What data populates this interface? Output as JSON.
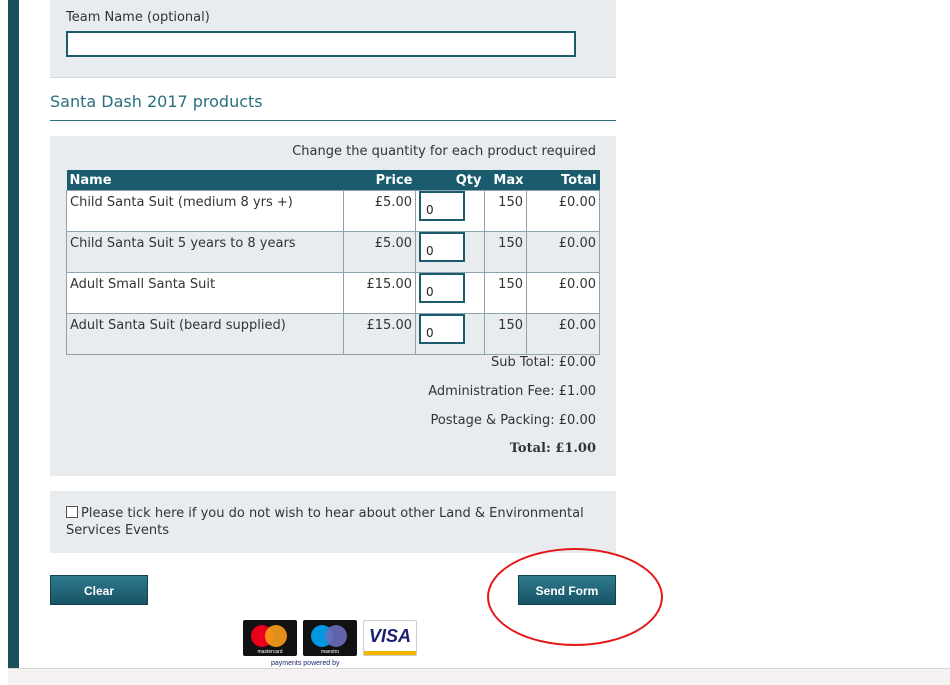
{
  "team": {
    "label": "Team Name (optional)",
    "value": ""
  },
  "products_section": {
    "title": "Santa Dash 2017 products",
    "instruction": "Change the quantity for each product required",
    "columns": {
      "name": "Name",
      "price": "Price",
      "qty": "Qty",
      "max": "Max",
      "total": "Total"
    },
    "rows": [
      {
        "name": "Child Santa Suit (medium 8 yrs +)",
        "price": "£5.00",
        "qty": "0",
        "max": "150",
        "total": "£0.00"
      },
      {
        "name": "Child Santa Suit 5 years to 8 years",
        "price": "£5.00",
        "qty": "0",
        "max": "150",
        "total": "£0.00"
      },
      {
        "name": "Adult Small Santa Suit",
        "price": "£15.00",
        "qty": "0",
        "max": "150",
        "total": "£0.00"
      },
      {
        "name": "Adult Santa Suit (beard supplied)",
        "price": "£15.00",
        "qty": "0",
        "max": "150",
        "total": "£0.00"
      }
    ],
    "summary": {
      "subtotal": "Sub Total: £0.00",
      "admin_fee": "Administration Fee: £1.00",
      "postage": "Postage & Packing: £0.00",
      "total": "Total: £1.00"
    }
  },
  "optout": {
    "label": "Please tick here if you do not wish to hear about other Land & Environmental Services Events",
    "checked": false
  },
  "buttons": {
    "clear": "Clear",
    "send": "Send Form"
  },
  "payment": {
    "mastercard_label": "mastercard",
    "maestro_label": "maestro",
    "visa_label": "VISA",
    "powered_by": "payments powered by"
  },
  "colors": {
    "accent": "#1a5c6e",
    "panel_bg": "#e8ecef",
    "highlight": "#e51616"
  }
}
